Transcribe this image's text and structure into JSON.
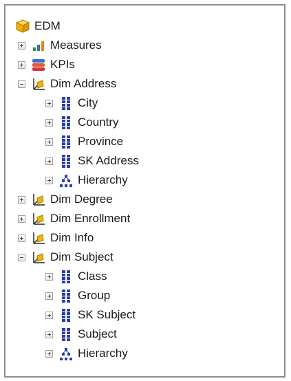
{
  "tree": {
    "root": {
      "label": "EDM",
      "icon": "cube-icon"
    },
    "items": [
      {
        "label": "Measures",
        "icon": "measures-bar-icon",
        "expander": "plus"
      },
      {
        "label": "KPIs",
        "icon": "kpi-stack-icon",
        "expander": "plus"
      },
      {
        "label": "Dim Address",
        "icon": "dimension-icon",
        "expander": "minus"
      },
      {
        "label": "City",
        "icon": "attribute-icon",
        "expander": "plus"
      },
      {
        "label": "Country",
        "icon": "attribute-icon",
        "expander": "plus"
      },
      {
        "label": "Province",
        "icon": "attribute-icon",
        "expander": "plus"
      },
      {
        "label": "SK Address",
        "icon": "attribute-icon",
        "expander": "plus"
      },
      {
        "label": "Hierarchy",
        "icon": "hierarchy-icon",
        "expander": "plus"
      },
      {
        "label": "Dim Degree",
        "icon": "dimension-icon",
        "expander": "plus"
      },
      {
        "label": "Dim Enrollment",
        "icon": "dimension-icon",
        "expander": "plus"
      },
      {
        "label": "Dim Info",
        "icon": "dimension-icon",
        "expander": "plus"
      },
      {
        "label": "Dim Subject",
        "icon": "dimension-icon",
        "expander": "minus"
      },
      {
        "label": "Class",
        "icon": "attribute-icon",
        "expander": "plus"
      },
      {
        "label": "Group",
        "icon": "attribute-icon",
        "expander": "plus"
      },
      {
        "label": "SK Subject",
        "icon": "attribute-icon",
        "expander": "plus"
      },
      {
        "label": "Subject",
        "icon": "attribute-icon",
        "expander": "plus"
      },
      {
        "label": "Hierarchy",
        "icon": "hierarchy-icon",
        "expander": "plus"
      }
    ]
  },
  "colors": {
    "border": "#8c8c8c",
    "text": "#1a1a1a",
    "attribute_blue": "#2b3fa8",
    "dimension_gold": "#e0a800",
    "cube_gold": "#f0b400"
  }
}
